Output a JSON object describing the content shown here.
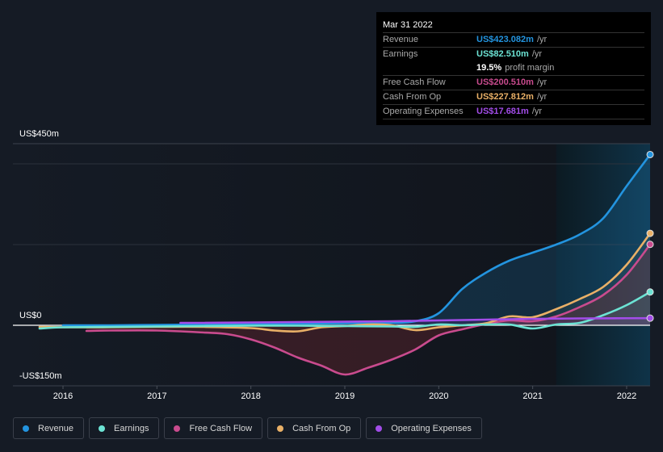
{
  "tooltip": {
    "date": "Mar 31 2022",
    "rows": [
      {
        "label": "Revenue",
        "value": "US$423.082m",
        "unit": "/yr",
        "color": "#2394df"
      },
      {
        "label": "Earnings",
        "value": "US$82.510m",
        "unit": "/yr",
        "color": "#6ce3d4"
      },
      {
        "label": "",
        "value": "19.5%",
        "unit": "profit margin",
        "color": "#ffffff"
      },
      {
        "label": "Free Cash Flow",
        "value": "US$200.510m",
        "unit": "/yr",
        "color": "#c94b8e"
      },
      {
        "label": "Cash From Op",
        "value": "US$227.812m",
        "unit": "/yr",
        "color": "#e9b067"
      },
      {
        "label": "Operating Expenses",
        "value": "US$17.681m",
        "unit": "/yr",
        "color": "#a24de8"
      }
    ]
  },
  "legend": [
    {
      "label": "Revenue",
      "color": "#2394df"
    },
    {
      "label": "Earnings",
      "color": "#6ce3d4"
    },
    {
      "label": "Free Cash Flow",
      "color": "#c94b8e"
    },
    {
      "label": "Cash From Op",
      "color": "#e9b067"
    },
    {
      "label": "Operating Expenses",
      "color": "#a24de8"
    }
  ],
  "chart_data": {
    "type": "line",
    "title": "",
    "xlabel": "",
    "ylabel": "",
    "y_tick_labels": [
      "US$450m",
      "US$0",
      "-US$150m"
    ],
    "x_tick_labels": [
      "2016",
      "2017",
      "2018",
      "2019",
      "2020",
      "2021",
      "2022"
    ],
    "x_ticks": [
      2016,
      2017,
      2018,
      2019,
      2020,
      2021,
      2022
    ],
    "xlim": [
      2015.6,
      2022.25
    ],
    "ylim": [
      -150,
      450
    ],
    "gridlines_y": [
      400,
      200,
      0
    ],
    "highlight_range": [
      2021.25,
      2022.25
    ],
    "series": [
      {
        "name": "Revenue",
        "color": "#2394df",
        "x": [
          2016.0,
          2016.5,
          2017.0,
          2017.5,
          2018.0,
          2018.5,
          2019.0,
          2019.5,
          2019.75,
          2020.0,
          2020.25,
          2020.5,
          2020.75,
          2021.0,
          2021.25,
          2021.5,
          2021.75,
          2022.0,
          2022.25
        ],
        "y": [
          0,
          0,
          1,
          2,
          3,
          4,
          5,
          6,
          10,
          30,
          90,
          130,
          160,
          180,
          200,
          225,
          265,
          345,
          423.082
        ]
      },
      {
        "name": "Earnings",
        "color": "#6ce3d4",
        "x": [
          2015.75,
          2016.0,
          2016.5,
          2017.0,
          2017.5,
          2018.0,
          2018.5,
          2019.0,
          2019.5,
          2019.75,
          2020.0,
          2020.25,
          2020.5,
          2020.75,
          2021.0,
          2021.25,
          2021.5,
          2021.75,
          2022.0,
          2022.25
        ],
        "y": [
          -8,
          -5,
          -4,
          -3,
          -2,
          -1,
          -1,
          -2,
          -3,
          -4,
          2,
          0,
          2,
          2,
          -8,
          2,
          6,
          25,
          50,
          82.51
        ]
      },
      {
        "name": "Free Cash Flow",
        "color": "#c94b8e",
        "x": [
          2016.25,
          2016.5,
          2017.0,
          2017.5,
          2017.75,
          2018.0,
          2018.25,
          2018.5,
          2018.75,
          2019.0,
          2019.25,
          2019.5,
          2019.75,
          2020.0,
          2020.25,
          2020.5,
          2020.75,
          2021.0,
          2021.25,
          2021.5,
          2021.75,
          2022.0,
          2022.25
        ],
        "y": [
          -14,
          -13,
          -13,
          -18,
          -22,
          -35,
          -55,
          -80,
          -100,
          -122,
          -105,
          -85,
          -60,
          -25,
          -10,
          3,
          12,
          10,
          22,
          45,
          75,
          125,
          200.51
        ]
      },
      {
        "name": "Cash From Op",
        "color": "#e9b067",
        "x": [
          2015.75,
          2016.0,
          2016.5,
          2017.0,
          2017.5,
          2018.0,
          2018.25,
          2018.5,
          2018.75,
          2019.0,
          2019.25,
          2019.5,
          2019.75,
          2020.0,
          2020.25,
          2020.5,
          2020.75,
          2021.0,
          2021.25,
          2021.5,
          2021.75,
          2022.0,
          2022.25
        ],
        "y": [
          -4,
          -5,
          -5,
          -4,
          -4,
          -7,
          -13,
          -15,
          -5,
          -2,
          2,
          0,
          -12,
          -5,
          0,
          5,
          22,
          20,
          40,
          65,
          95,
          150,
          227.812
        ]
      },
      {
        "name": "Operating Expenses",
        "color": "#a24de8",
        "x": [
          2017.25,
          2017.5,
          2018.0,
          2018.5,
          2019.0,
          2019.5,
          2020.0,
          2020.5,
          2021.0,
          2021.5,
          2022.0,
          2022.25
        ],
        "y": [
          6,
          6,
          7,
          8,
          9,
          10,
          12,
          14,
          16,
          17,
          17.5,
          17.681
        ]
      }
    ]
  }
}
